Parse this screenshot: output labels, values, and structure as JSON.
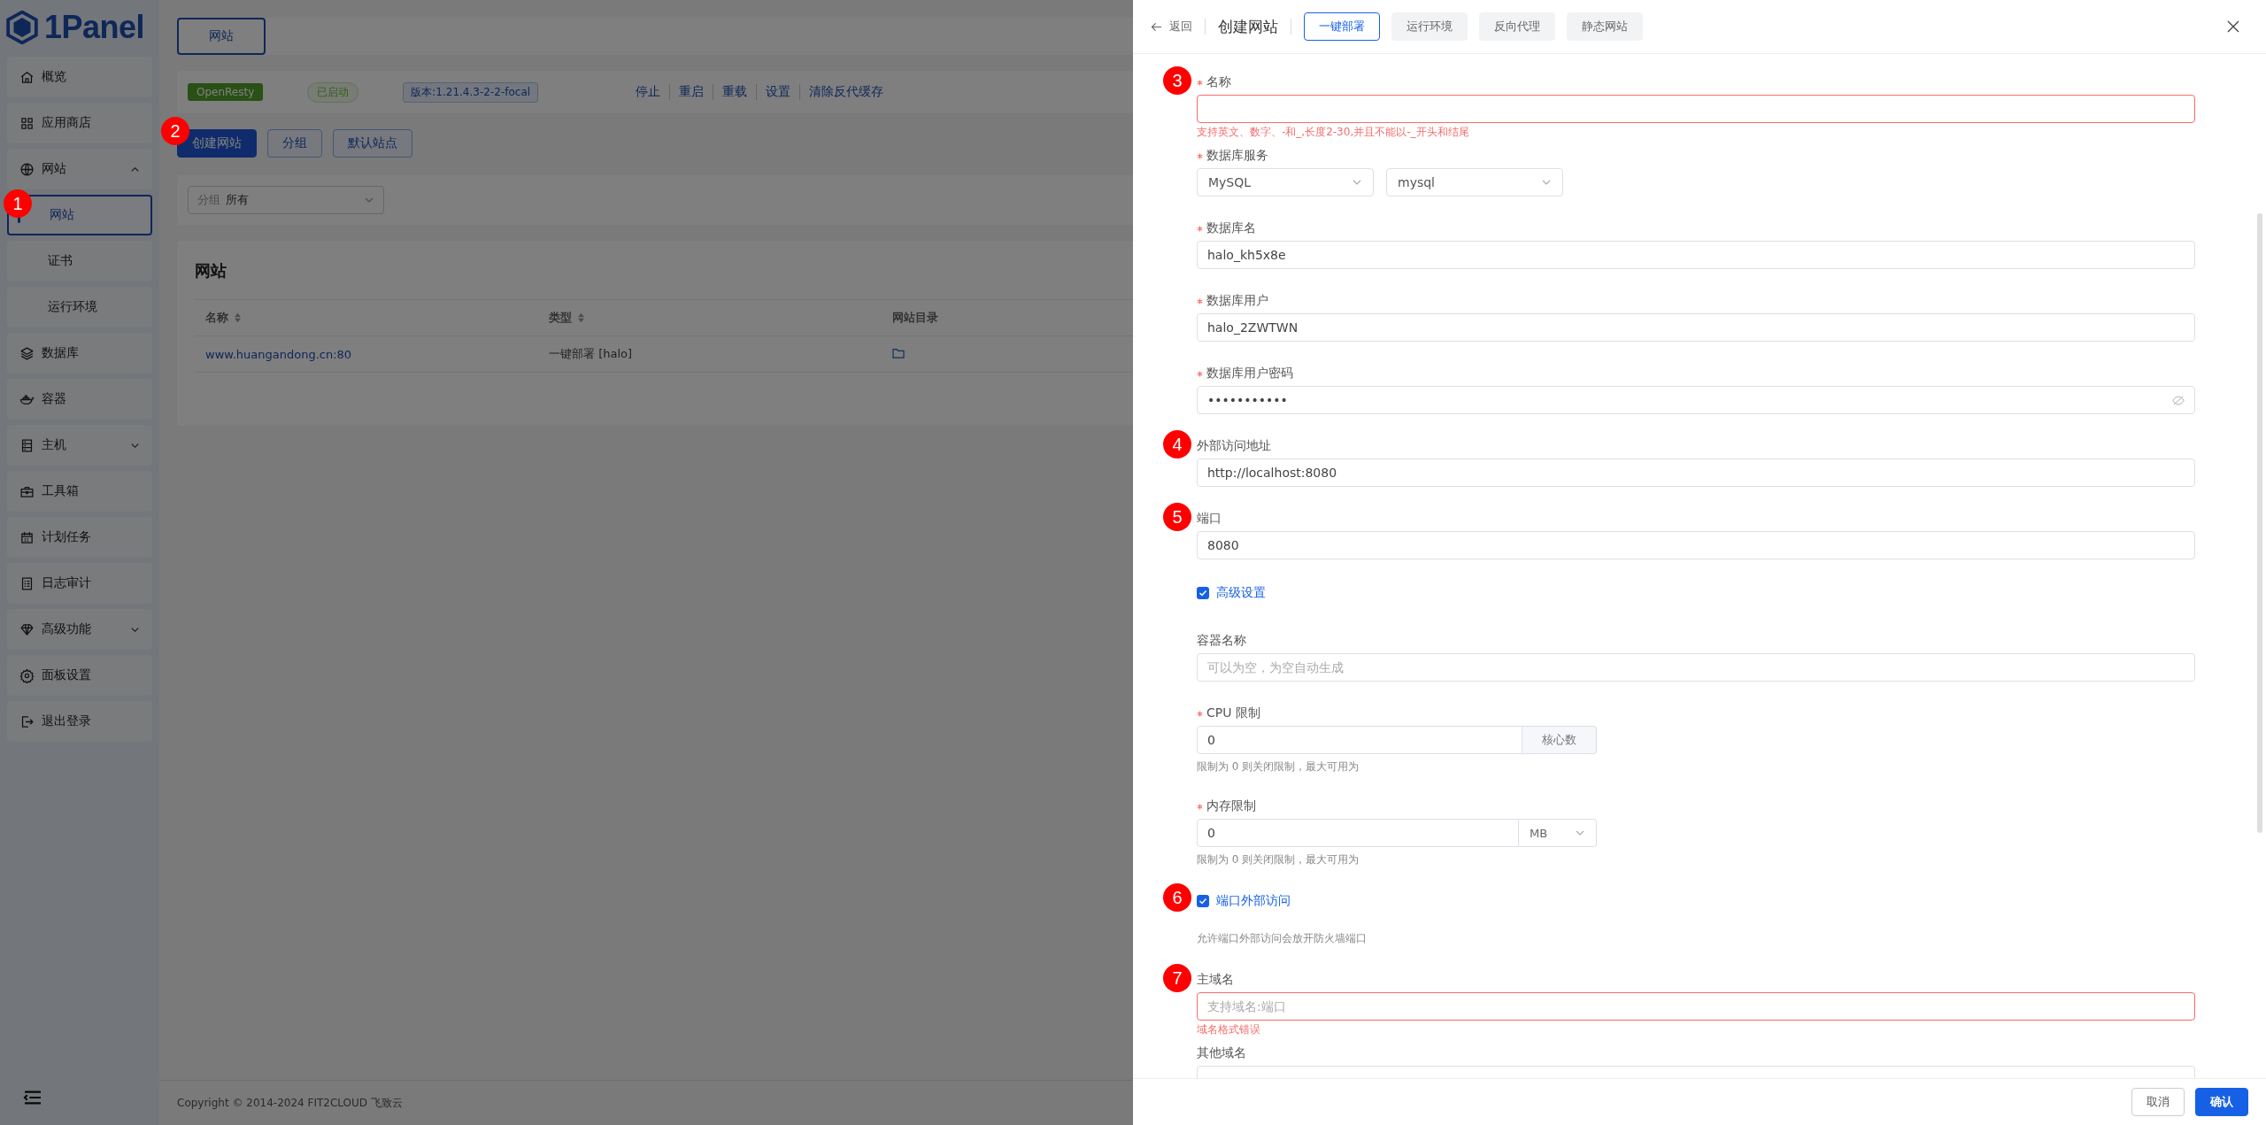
{
  "sidebar": {
    "logo": "1Panel",
    "items": [
      {
        "label": "概览",
        "selected": false
      },
      {
        "label": "应用商店",
        "selected": false
      },
      {
        "label": "网站",
        "selected": false,
        "expanded": true,
        "children": [
          {
            "label": "网站",
            "selected": true,
            "marker": "1"
          },
          {
            "label": "证书",
            "selected": false
          },
          {
            "label": "运行环境",
            "selected": false
          }
        ]
      },
      {
        "label": "数据库",
        "selected": false
      },
      {
        "label": "容器",
        "selected": false
      },
      {
        "label": "主机",
        "selected": false,
        "expanded": false
      },
      {
        "label": "工具箱",
        "selected": false
      },
      {
        "label": "计划任务",
        "selected": false
      },
      {
        "label": "日志审计",
        "selected": false
      },
      {
        "label": "高级功能",
        "selected": false,
        "expanded": false
      },
      {
        "label": "面板设置",
        "selected": false
      },
      {
        "label": "退出登录",
        "selected": false
      }
    ]
  },
  "main": {
    "tabs": [
      {
        "label": "网站",
        "selected": true
      }
    ],
    "server": {
      "app": "OpenResty",
      "status": "已启动",
      "version": "版本:1.21.4.3-2-2-focal",
      "actions": [
        "停止",
        "重启",
        "重载",
        "设置",
        "清除反代缓存"
      ]
    },
    "buttons": [
      {
        "label": "创建网站",
        "kind": "primary",
        "marker": "2"
      },
      {
        "label": "分组",
        "kind": "plain"
      },
      {
        "label": "默认站点",
        "kind": "plain"
      }
    ],
    "filter": {
      "label": "分组",
      "value": "所有"
    },
    "table": {
      "title": "网站",
      "columns": [
        {
          "label": "名称",
          "sortable": true
        },
        {
          "label": "类型",
          "sortable": true
        },
        {
          "label": "网站目录",
          "sortable": false
        }
      ],
      "rows": [
        {
          "name": "www.huangandong.cn:80",
          "type": "一键部署 [halo]"
        }
      ]
    },
    "footer": "Copyright © 2014-2024 FIT2CLOUD 飞致云"
  },
  "drawer": {
    "back": "返回",
    "title": "创建网站",
    "tabs": [
      {
        "label": "一键部署",
        "selected": true
      },
      {
        "label": "运行环境",
        "selected": false
      },
      {
        "label": "反向代理",
        "selected": false
      },
      {
        "label": "静态网站",
        "selected": false
      }
    ],
    "fields": [
      {
        "kind": "input",
        "label": "名称",
        "required": true,
        "marker": "3",
        "error": "支持英文、数字、-和_,长度2-30,并且不能以-_开头和结尾"
      },
      {
        "kind": "select_pair",
        "label": "数据库服务",
        "required": true,
        "options": [
          "MySQL",
          "mysql"
        ]
      },
      {
        "kind": "input",
        "label": "数据库名",
        "required": true,
        "value": "halo_kh5x8e"
      },
      {
        "kind": "input",
        "label": "数据库用户",
        "required": true,
        "value": "halo_2ZWTWN"
      },
      {
        "kind": "password",
        "label": "数据库用户密码",
        "required": true,
        "value": "•••••••••••"
      },
      {
        "kind": "input",
        "label": "外部访问地址",
        "required": false,
        "marker": "4",
        "value": "http://localhost:8080"
      },
      {
        "kind": "input",
        "label": "端口",
        "required": false,
        "marker": "5",
        "value": "8080"
      },
      {
        "kind": "checkbox",
        "label": "高级设置",
        "checked": true
      },
      {
        "kind": "input",
        "label": "容器名称",
        "required": false,
        "placeholder": "可以为空，为空自动生成"
      },
      {
        "kind": "input_append",
        "label": "CPU 限制",
        "required": true,
        "value": "0",
        "append": "核心数",
        "hint": "限制为 0 则关闭限制，最大可用为"
      },
      {
        "kind": "input_select",
        "label": "内存限制",
        "required": true,
        "value": "0",
        "unit": "MB",
        "hint": "限制为 0 则关闭限制，最大可用为"
      },
      {
        "kind": "checkbox",
        "label": "端口外部访问",
        "checked": true,
        "marker": "6",
        "hint": "允许端口外部访问会放开防火墙端口"
      },
      {
        "kind": "input",
        "label": "主域名",
        "required": false,
        "marker": "7",
        "placeholder": "支持域名:端口",
        "error": "域名格式错误"
      },
      {
        "kind": "textarea",
        "label": "其他域名",
        "required": false
      }
    ],
    "buttons": [
      {
        "label": "取消",
        "kind": "plain"
      },
      {
        "label": "确认",
        "kind": "primary"
      }
    ]
  }
}
